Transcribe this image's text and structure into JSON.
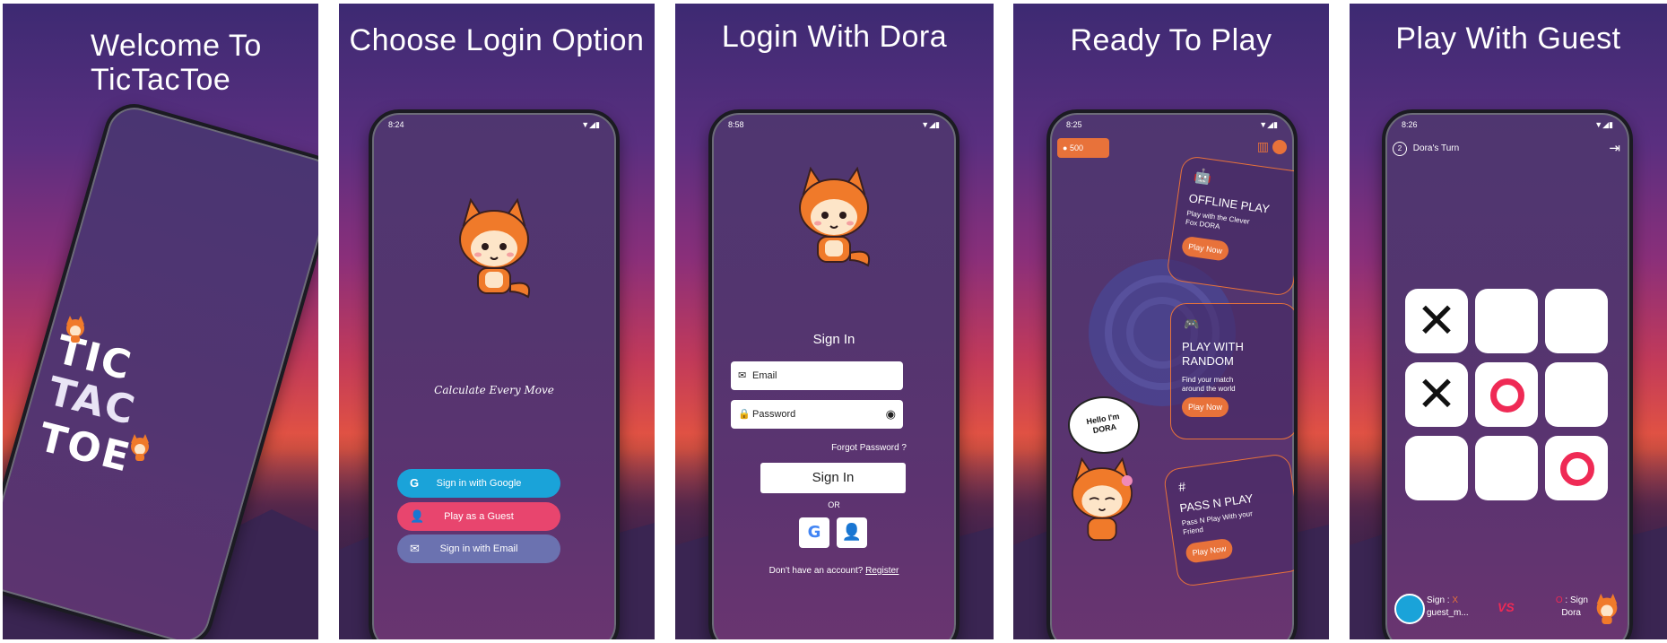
{
  "panels": [
    {
      "title_line1": "Welcome To",
      "title_line2": "TicTacToe",
      "logo_words": [
        "TIC",
        "TAC",
        "TOE"
      ]
    },
    {
      "title": "Choose Login Option",
      "status_time": "8:24",
      "tagline": "Calculate Every Move",
      "buttons": {
        "google": "Sign in with Google",
        "guest": "Play as a Guest",
        "email": "Sign in with Email"
      }
    },
    {
      "title": "Login With Dora",
      "status_time": "8:58",
      "heading": "Sign In",
      "email_placeholder": "Email",
      "password_placeholder": "Password",
      "forgot": "Forgot Password ?",
      "submit": "Sign In",
      "or": "OR",
      "no_account": "Don't have an account?",
      "register": "Register"
    },
    {
      "title": "Ready To Play",
      "status_time": "8:25",
      "coins": "500",
      "speech": "Hello I'm DORA",
      "cards": [
        {
          "title": "OFFLINE PLAY",
          "desc": "Play with the Clever Fox DORA",
          "cta": "Play Now"
        },
        {
          "title": "PLAY WITH RANDOM",
          "desc": "Find your match around the world",
          "cta": "Play Now"
        },
        {
          "title": "PASS N PLAY",
          "desc": "Pass N Play With your Friend",
          "cta": "Play Now"
        }
      ]
    },
    {
      "title": "Play With Guest",
      "status_time": "8:26",
      "turn": "Dora's Turn",
      "turn_count": "2",
      "board": [
        "X",
        "",
        "",
        "X",
        "O",
        "",
        "",
        "",
        "O"
      ],
      "player1": {
        "sign_label": "Sign :",
        "sign": "X",
        "name": "guest_m..."
      },
      "player2": {
        "sign_label": ": Sign",
        "sign": "O",
        "name": "Dora"
      },
      "vs": "VS"
    }
  ],
  "colors": {
    "accent_orange": "#e8723a",
    "google_blue": "#1aa3d9",
    "guest_pink": "#e8456e",
    "email_slate": "#6b72b0",
    "o_red": "#ef2a55"
  }
}
